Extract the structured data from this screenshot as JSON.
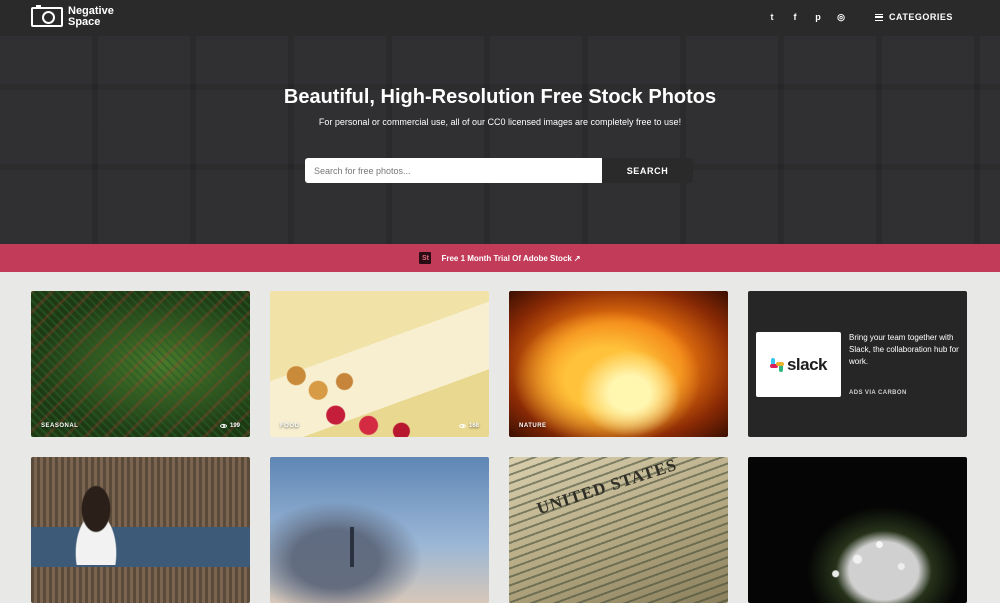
{
  "brand": {
    "name_line1": "Negative",
    "name_line2": "Space"
  },
  "social": [
    {
      "icon": "twitter-icon",
      "glyph": "t"
    },
    {
      "icon": "facebook-icon",
      "glyph": "f"
    },
    {
      "icon": "pinterest-icon",
      "glyph": "p"
    },
    {
      "icon": "instagram-icon",
      "glyph": "◎"
    }
  ],
  "nav": {
    "categories_label": "CATEGORIES"
  },
  "hero": {
    "title": "Beautiful, High-Resolution Free Stock Photos",
    "subtitle": "For personal or commercial use, all of our CC0 licensed images are completely free to use!"
  },
  "search": {
    "placeholder": "Search for free photos...",
    "button_label": "SEARCH"
  },
  "promo": {
    "icon_text": "St",
    "text": "Free 1 Month Trial Of Adobe Stock"
  },
  "cards": [
    {
      "tag": "SEASONAL",
      "views": "199"
    },
    {
      "tag": "FOOD",
      "views": "168"
    },
    {
      "tag": "NATURE",
      "views": ""
    }
  ],
  "ad": {
    "brand_word": "slack",
    "text": "Bring your team together with Slack, the collaboration hub for work.",
    "via": "ADS VIA CARBON"
  },
  "colors": {
    "accent": "#c23c5a",
    "dark": "#2a2a2b"
  }
}
